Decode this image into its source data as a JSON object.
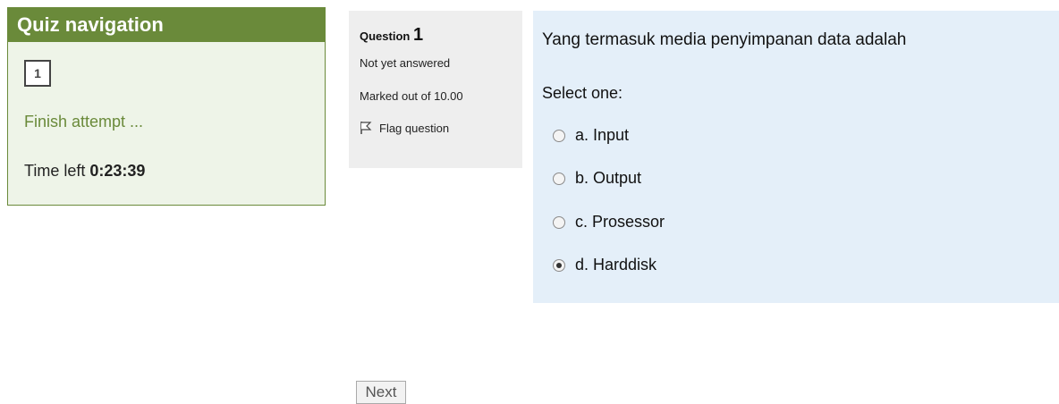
{
  "quiz_nav": {
    "title": "Quiz navigation",
    "question_buttons": [
      "1"
    ],
    "finish_link": "Finish attempt ...",
    "time_left_label": "Time left",
    "time_left_value": "0:23:39"
  },
  "question_info": {
    "question_label": "Question",
    "question_number": "1",
    "status": "Not yet answered",
    "marks": "Marked out of 10.00",
    "flag_label": "Flag question"
  },
  "question": {
    "text": "Yang termasuk media penyimpanan data adalah",
    "prompt": "Select one:",
    "options": [
      {
        "label": "a. Input",
        "checked": false
      },
      {
        "label": "b. Output",
        "checked": false
      },
      {
        "label": "c. Prosessor",
        "checked": false
      },
      {
        "label": "d. Harddisk",
        "checked": true
      }
    ]
  },
  "footer": {
    "next_label": "Next"
  },
  "colors": {
    "nav_header": "#6a8a3a",
    "nav_background": "#eef4e8",
    "info_background": "#eeeeee",
    "content_background": "#e4eff9"
  }
}
